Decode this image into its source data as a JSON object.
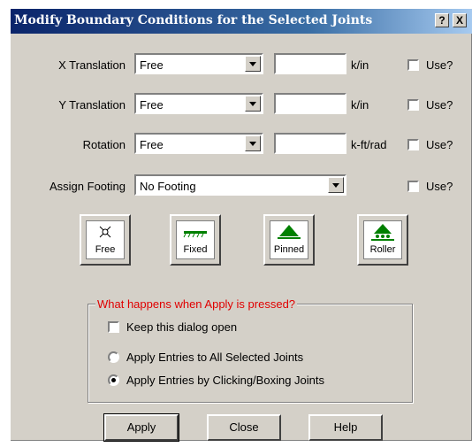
{
  "window": {
    "title": "Modify Boundary Conditions for the Selected Joints",
    "help_label": "?",
    "close_label": "X"
  },
  "rows": [
    {
      "label": "X Translation",
      "combo": "Free",
      "value": "",
      "unit": "k/in",
      "use_label": "Use?"
    },
    {
      "label": "Y Translation",
      "combo": "Free",
      "value": "",
      "unit": "k/in",
      "use_label": "Use?"
    },
    {
      "label": "Rotation",
      "combo": "Free",
      "value": "",
      "unit": "k-ft/rad",
      "use_label": "Use?"
    }
  ],
  "footing": {
    "label": "Assign Footing",
    "combo": "No Footing",
    "use_label": "Use?"
  },
  "presets": [
    {
      "label": "Free"
    },
    {
      "label": "Fixed"
    },
    {
      "label": "Pinned"
    },
    {
      "label": "Roller"
    }
  ],
  "apply_group": {
    "title": "What happens when Apply is pressed?",
    "keep_open_label": "Keep this dialog open",
    "keep_open_checked": false,
    "option_all": "Apply Entries to All Selected Joints",
    "option_click": "Apply Entries by Clicking/Boxing Joints",
    "selected_option": "click"
  },
  "buttons": {
    "apply": "Apply",
    "close": "Close",
    "help": "Help"
  },
  "colors": {
    "group_title": "#e00000",
    "support_green": "#008000",
    "title_bar": "#0a246a"
  }
}
